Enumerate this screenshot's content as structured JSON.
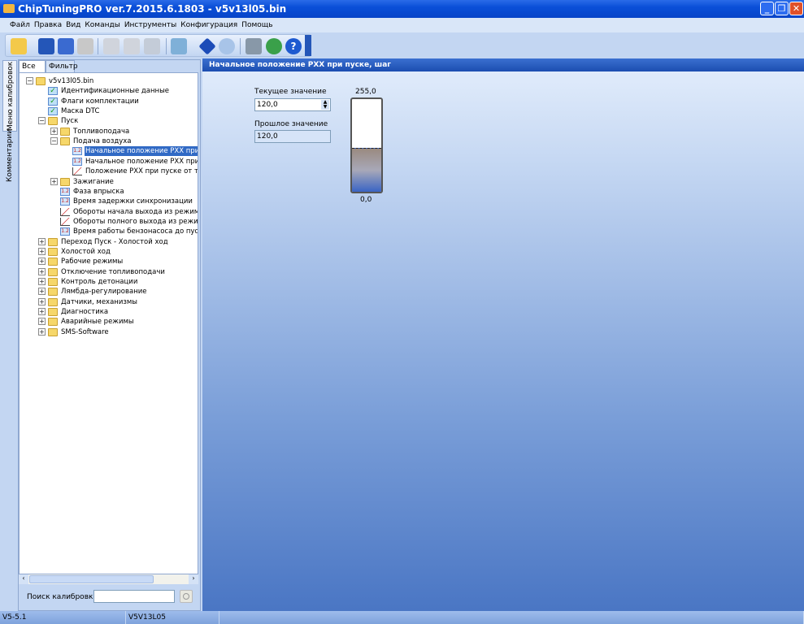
{
  "window": {
    "title": "ChipTuningPRO ver.7.2015.6.1803 - v5v13l05.bin"
  },
  "menu": [
    "Файл",
    "Правка",
    "Вид",
    "Команды",
    "Инструменты",
    "Конфигурация",
    "Помощь"
  ],
  "toolbar": [
    "open-folder-icon",
    "save-icon",
    "save-as-icon",
    "print-icon",
    "copy-icon",
    "paste-icon",
    "undo-icon",
    "compare-icon",
    "info-icon",
    "search-zoom-icon",
    "tools-icon",
    "web-update-icon",
    "help-icon"
  ],
  "side_tabs": {
    "calibration_menu": "Меню калибровок",
    "comments": "Комментарии"
  },
  "panel_tabs": {
    "all": "Все",
    "filter": "Фильтр"
  },
  "tree": [
    {
      "label": "v5v13l05.bin",
      "level": 0,
      "icon": "folder",
      "exp": "-"
    },
    {
      "label": "Идентификационные данные",
      "level": 1,
      "icon": "check"
    },
    {
      "label": "Флаги комплектации",
      "level": 1,
      "icon": "check"
    },
    {
      "label": "Маска DTC",
      "level": 1,
      "icon": "check"
    },
    {
      "label": "Пуск",
      "level": 1,
      "icon": "folder",
      "exp": "-"
    },
    {
      "label": "Топливоподача",
      "level": 2,
      "icon": "folder",
      "exp": "+"
    },
    {
      "label": "Подача воздуха",
      "level": 2,
      "icon": "folder",
      "exp": "-"
    },
    {
      "label": "Начальное положение РХХ при пуске, шаг",
      "level": 3,
      "icon": "num",
      "selected": true
    },
    {
      "label": "Начальное положение РХХ при пуске",
      "level": 3,
      "icon": "num"
    },
    {
      "label": "Положение РХХ при пуске от температуры",
      "level": 3,
      "icon": "graph"
    },
    {
      "label": "Зажигание",
      "level": 2,
      "icon": "folder",
      "exp": "+"
    },
    {
      "label": "Фаза впрыска",
      "level": 2,
      "icon": "num"
    },
    {
      "label": "Время задержки синхронизации",
      "level": 2,
      "icon": "num"
    },
    {
      "label": "Обороты начала выхода из режима пуска",
      "level": 2,
      "icon": "graph"
    },
    {
      "label": "Обороты полного выхода из режима пуска",
      "level": 2,
      "icon": "graph"
    },
    {
      "label": "Время работы бензонасоса до пуска",
      "level": 2,
      "icon": "num"
    },
    {
      "label": "Переход Пуск - Холостой ход",
      "level": 1,
      "icon": "folder",
      "exp": "+"
    },
    {
      "label": "Холостой ход",
      "level": 1,
      "icon": "folder",
      "exp": "+"
    },
    {
      "label": "Рабочие режимы",
      "level": 1,
      "icon": "folder",
      "exp": "+"
    },
    {
      "label": "Отключение топливоподачи",
      "level": 1,
      "icon": "folder",
      "exp": "+"
    },
    {
      "label": "Контроль детонации",
      "level": 1,
      "icon": "folder",
      "exp": "+"
    },
    {
      "label": "Лямбда-регулирование",
      "level": 1,
      "icon": "folder",
      "exp": "+"
    },
    {
      "label": "Датчики, механизмы",
      "level": 1,
      "icon": "folder",
      "exp": "+"
    },
    {
      "label": "Диагностика",
      "level": 1,
      "icon": "folder",
      "exp": "+"
    },
    {
      "label": "Аварийные режимы",
      "level": 1,
      "icon": "folder",
      "exp": "+"
    },
    {
      "label": "SMS-Software",
      "level": 1,
      "icon": "folder",
      "exp": "+"
    }
  ],
  "search": {
    "label": "Поиск калибровки",
    "value": ""
  },
  "main": {
    "title": "Начальное положение РХХ при пуске, шаг",
    "current_label": "Текущее значение",
    "current_value": "120,0",
    "previous_label": "Прошлое значение",
    "previous_value": "120,0",
    "gauge_max": "255,0",
    "gauge_min": "0,0",
    "gauge_value": 120,
    "gauge_range": [
      0,
      255
    ]
  },
  "status": {
    "left": "V5-5.1",
    "middle": "V5V13L05",
    "right": ""
  }
}
